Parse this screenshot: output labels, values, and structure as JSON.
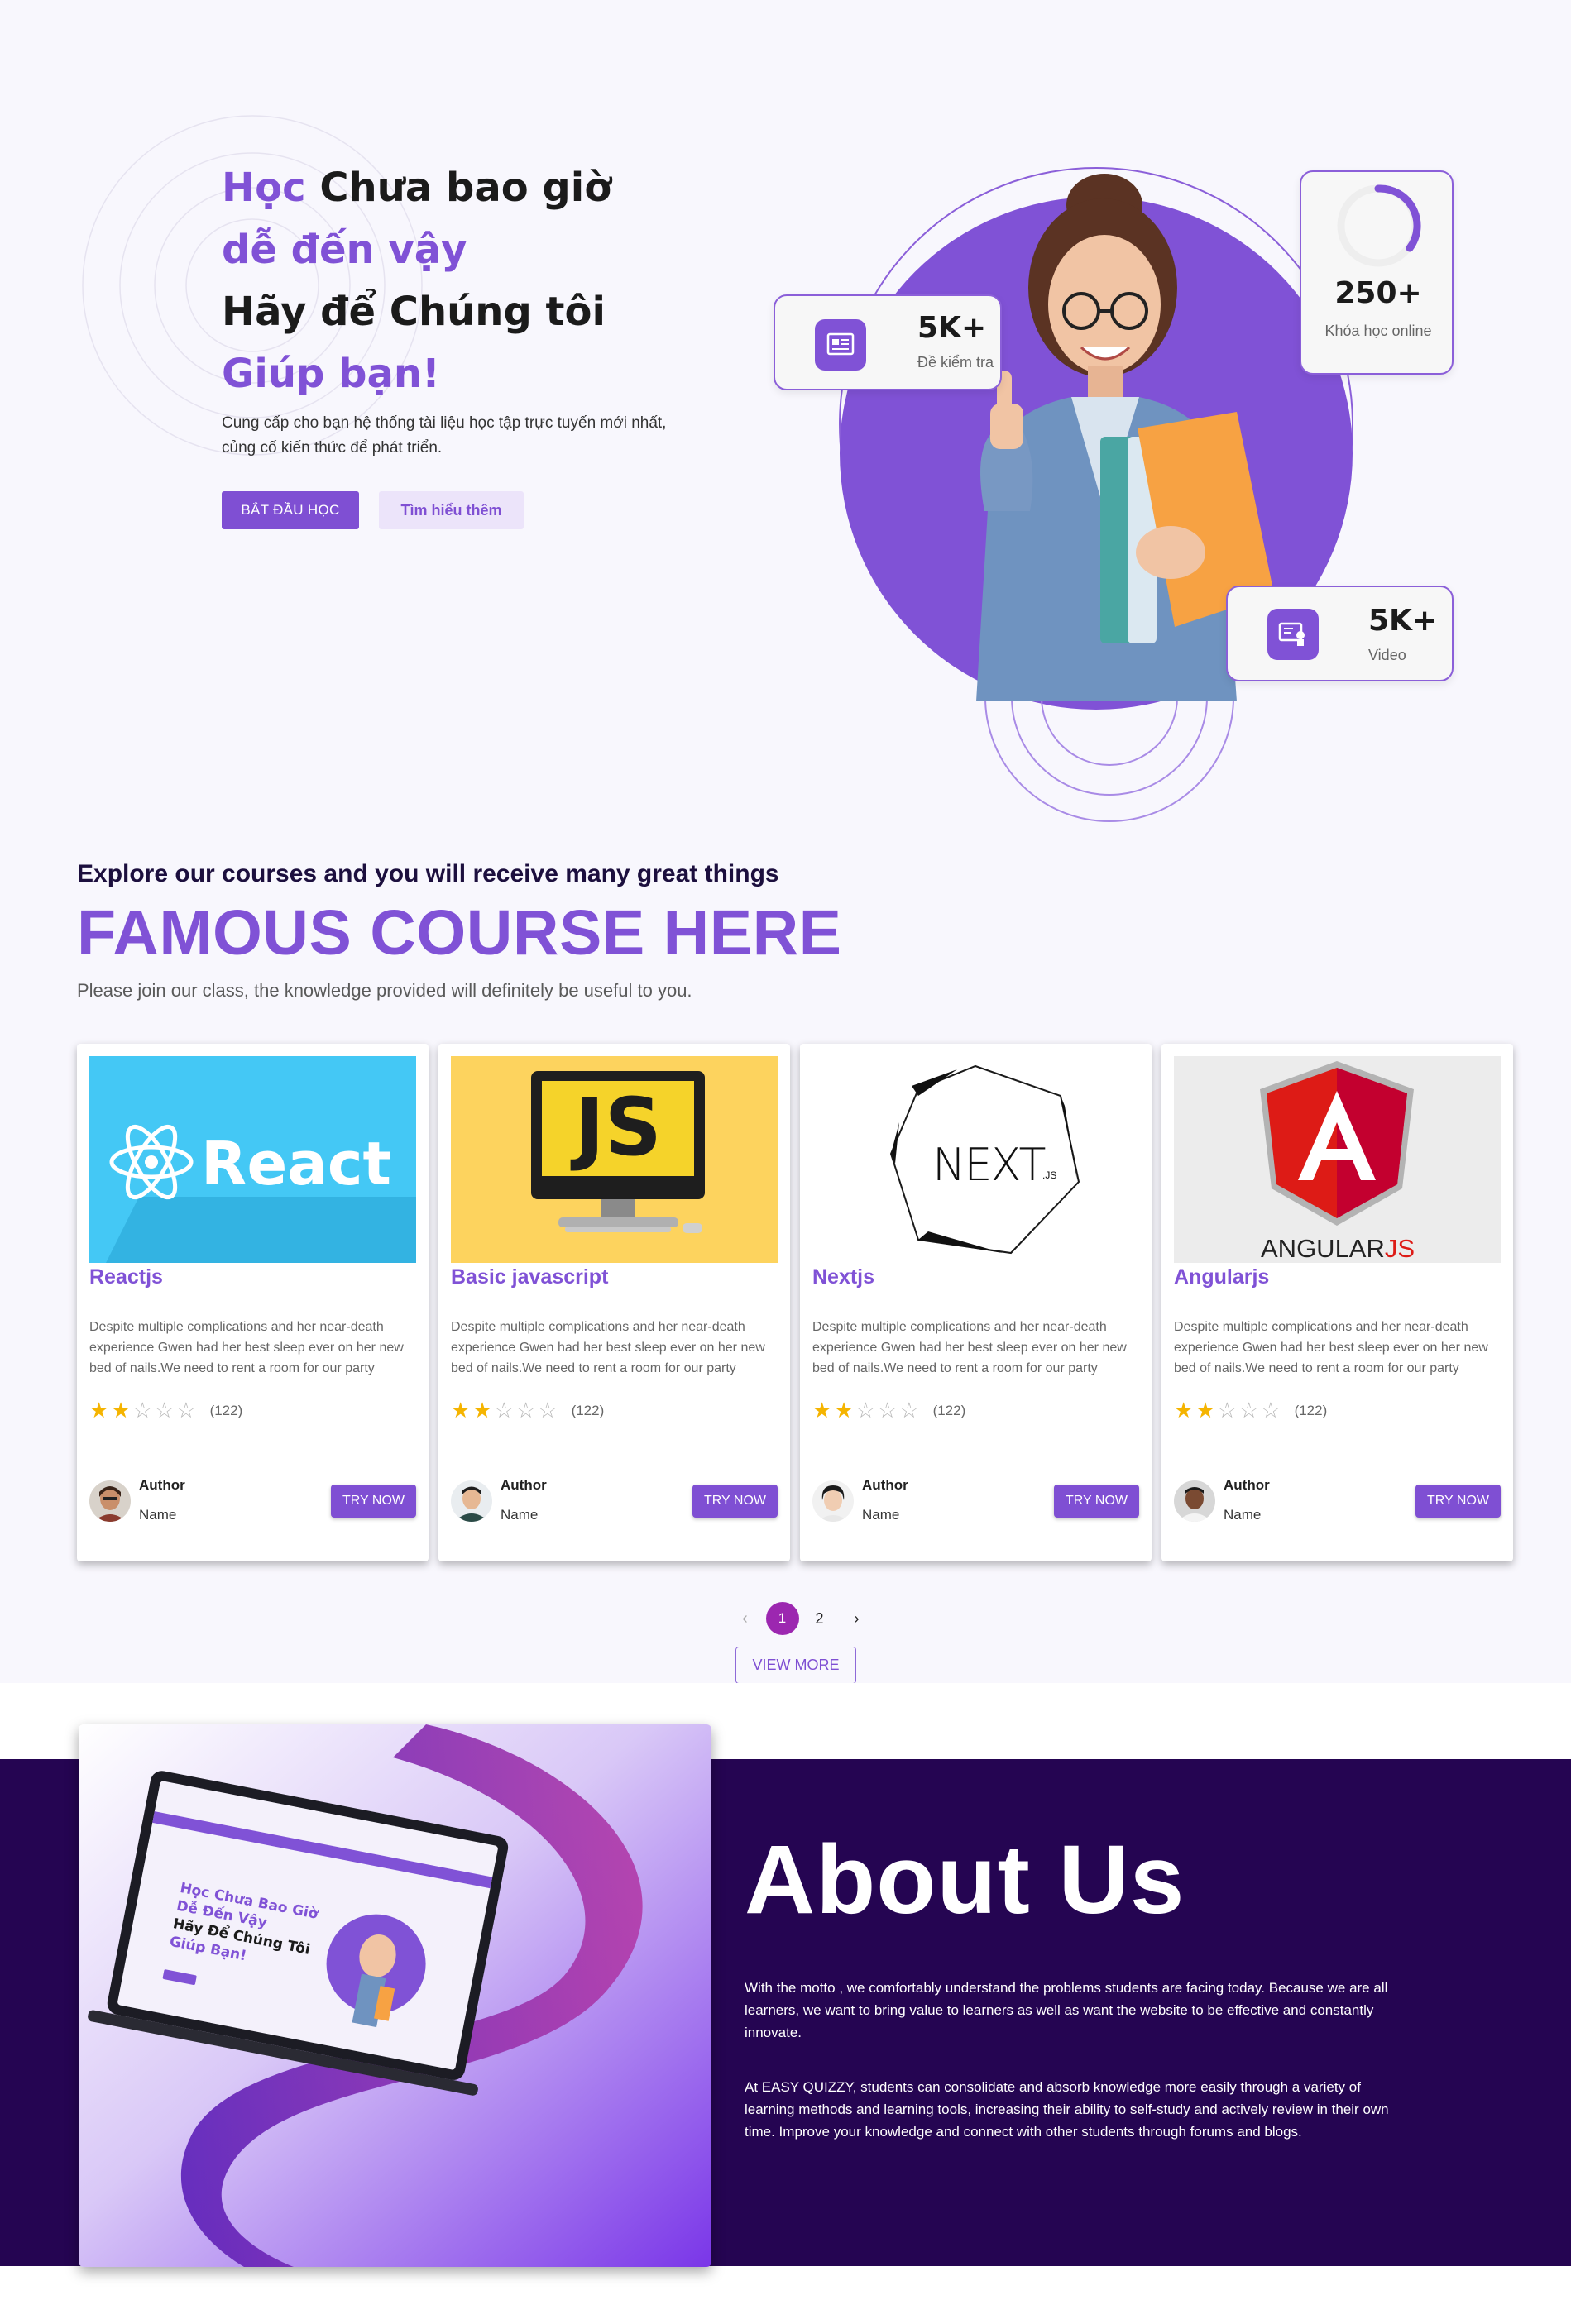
{
  "hero": {
    "title_line1_accent": "Học",
    "title_line1_rest": " Chưa bao giờ",
    "title_line2": "dễ đến vậy",
    "title_line3": "Hãy để Chúng tôi",
    "title_line4": "Giúp bạn!",
    "subtitle_line1": "Cung cấp cho bạn hệ thống tài liệu học tập trực tuyến mới nhất,",
    "subtitle_line2": "củng cố kiến thức để phát triển.",
    "start_button": "BẮT ĐẦU HỌC",
    "learn_more_button": "Tìm hiểu thêm",
    "stats": [
      {
        "value": "5K+",
        "label": "Đề kiểm tra"
      },
      {
        "value": "250+",
        "label": "Khóa học online"
      },
      {
        "value": "5K+",
        "label": "Video"
      }
    ]
  },
  "courses": {
    "eyebrow": "Explore our courses and you will receive many great things",
    "title": "FAMOUS COURSE HERE",
    "subtitle": "Please join our class, the knowledge provided will definitely be useful to you.",
    "items": [
      {
        "title": "Reactjs",
        "image_text": "React",
        "description": "Despite multiple complications and her near-death experience Gwen had her best sleep ever on her new bed of nails.We need to rent a room for our party",
        "rating": 2,
        "max_rating": 5,
        "rating_count": "(122)",
        "author_label": "Author",
        "author_name": "Name",
        "button": "TRY NOW"
      },
      {
        "title": "Basic javascript",
        "image_text": "JS",
        "description": "Despite multiple complications and her near-death experience Gwen had her best sleep ever on her new bed of nails.We need to rent a room for our party",
        "rating": 2,
        "max_rating": 5,
        "rating_count": "(122)",
        "author_label": "Author",
        "author_name": "Name",
        "button": "TRY NOW"
      },
      {
        "title": "Nextjs",
        "image_text": "NEXT",
        "image_text_small": ".JS",
        "description": "Despite multiple complications and her near-death experience Gwen had her best sleep ever on her new bed of nails.We need to rent a room for our party",
        "rating": 2,
        "max_rating": 5,
        "rating_count": "(122)",
        "author_label": "Author",
        "author_name": "Name",
        "button": "TRY NOW"
      },
      {
        "title": "Angularjs",
        "image_text": "ANGULAR",
        "image_text_accent": "JS",
        "description": "Despite multiple complications and her near-death experience Gwen had her best sleep ever on her new bed of nails.We need to rent a room for our party",
        "rating": 2,
        "max_rating": 5,
        "rating_count": "(122)",
        "author_label": "Author",
        "author_name": "Name",
        "button": "TRY NOW"
      }
    ],
    "pagination": {
      "prev": "‹",
      "pages": [
        "1",
        "2"
      ],
      "current": "1",
      "next": "›"
    },
    "view_more": "VIEW MORE"
  },
  "about": {
    "title": "About Us",
    "paragraph1": "With the motto , we comfortably understand the problems students are facing today. Because we are all learners, we want to bring value to learners as well as want the website to be effective and constantly innovate.",
    "paragraph2": "At EASY QUIZZY, students can consolidate and absorb knowledge more easily through a variety of learning methods and learning tools, increasing their ability to self-study and actively review in their own time. Improve your knowledge and connect with other students through forums and blogs.",
    "mockup": {
      "line1": "Học Chưa Bao Giờ",
      "line2": "Dễ Đến Vậy",
      "line3": "Hãy Để Chúng Tôi",
      "line4": "Giúp Bạn!"
    }
  },
  "colors": {
    "accent": "#8052d6",
    "dark_purple": "#250552",
    "star": "#f5b400",
    "page_active": "#9c27b0"
  }
}
